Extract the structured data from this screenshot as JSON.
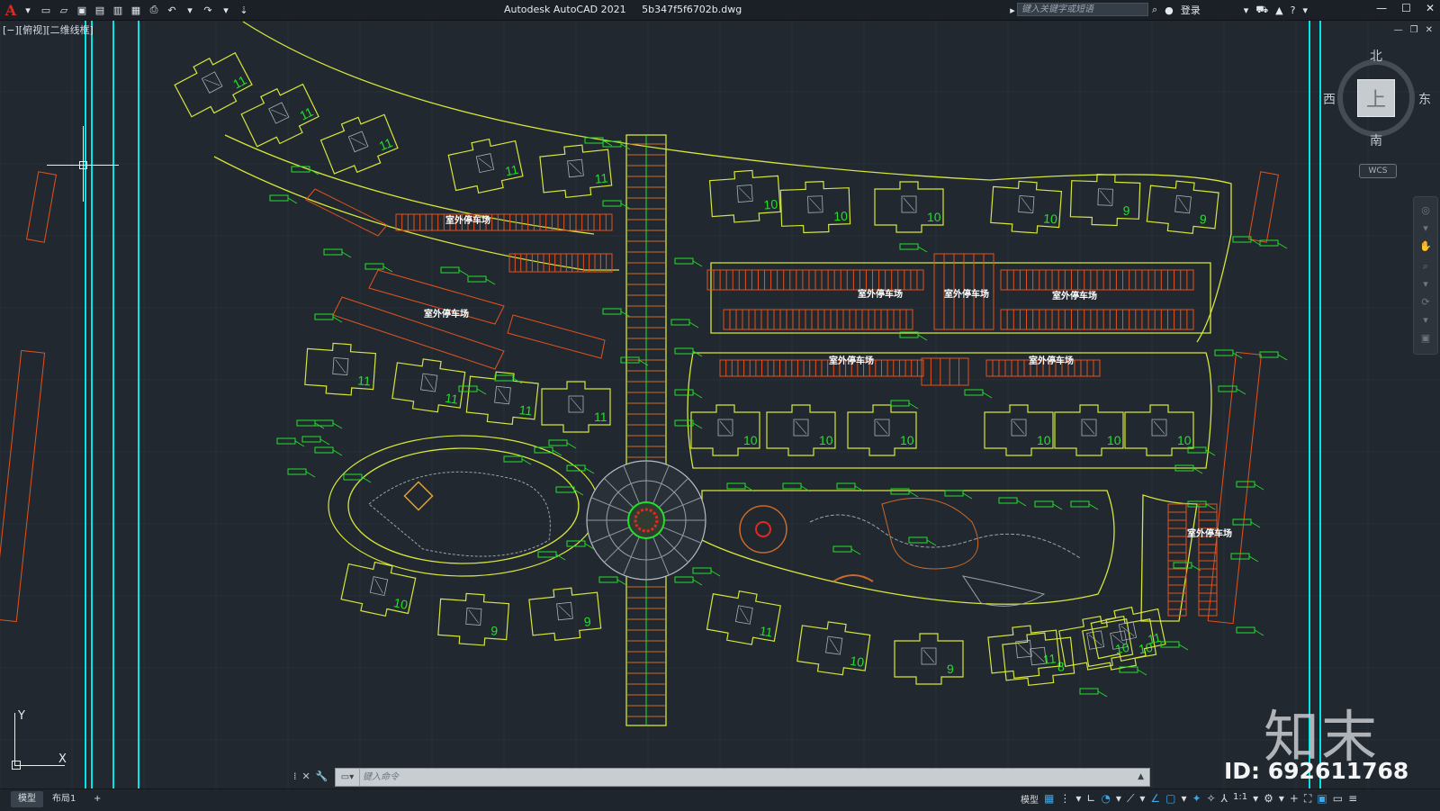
{
  "app": {
    "title": "Autodesk AutoCAD 2021",
    "file": "5b347f5f6702b.dwg",
    "search_placeholder": "键入关键字或短语",
    "login": "登录"
  },
  "viewport": {
    "label": "[−][俯视][二维线框]"
  },
  "viewcube": {
    "north": "北",
    "south": "南",
    "east": "东",
    "west": "西",
    "face": "上",
    "wcs": "WCS"
  },
  "drawing": {
    "parking_label": "室外停车场",
    "building_numbers": [
      "11",
      "11",
      "11",
      "11",
      "11",
      "10",
      "10",
      "10",
      "10",
      "9",
      "9",
      "11",
      "11",
      "11",
      "11",
      "10",
      "10",
      "10",
      "10",
      "10",
      "10",
      "10",
      "9",
      "9",
      "11",
      "10",
      "9",
      "8",
      "10",
      "11",
      "10",
      "11"
    ]
  },
  "ucs": {
    "x": "X",
    "y": "Y"
  },
  "command": {
    "placeholder": "键入命令"
  },
  "tabs": [
    {
      "label": "模型"
    },
    {
      "label": "布局1"
    }
  ],
  "status": {
    "model": "模型",
    "scale": "1:1"
  },
  "watermark": {
    "brand": "知末",
    "id": "ID: 692611768"
  },
  "colors": {
    "background": "#212830",
    "outline": "#d6e63a",
    "parking": "#e5521c",
    "tree": "#22e02a",
    "cyan_line": "#00e6e6"
  }
}
